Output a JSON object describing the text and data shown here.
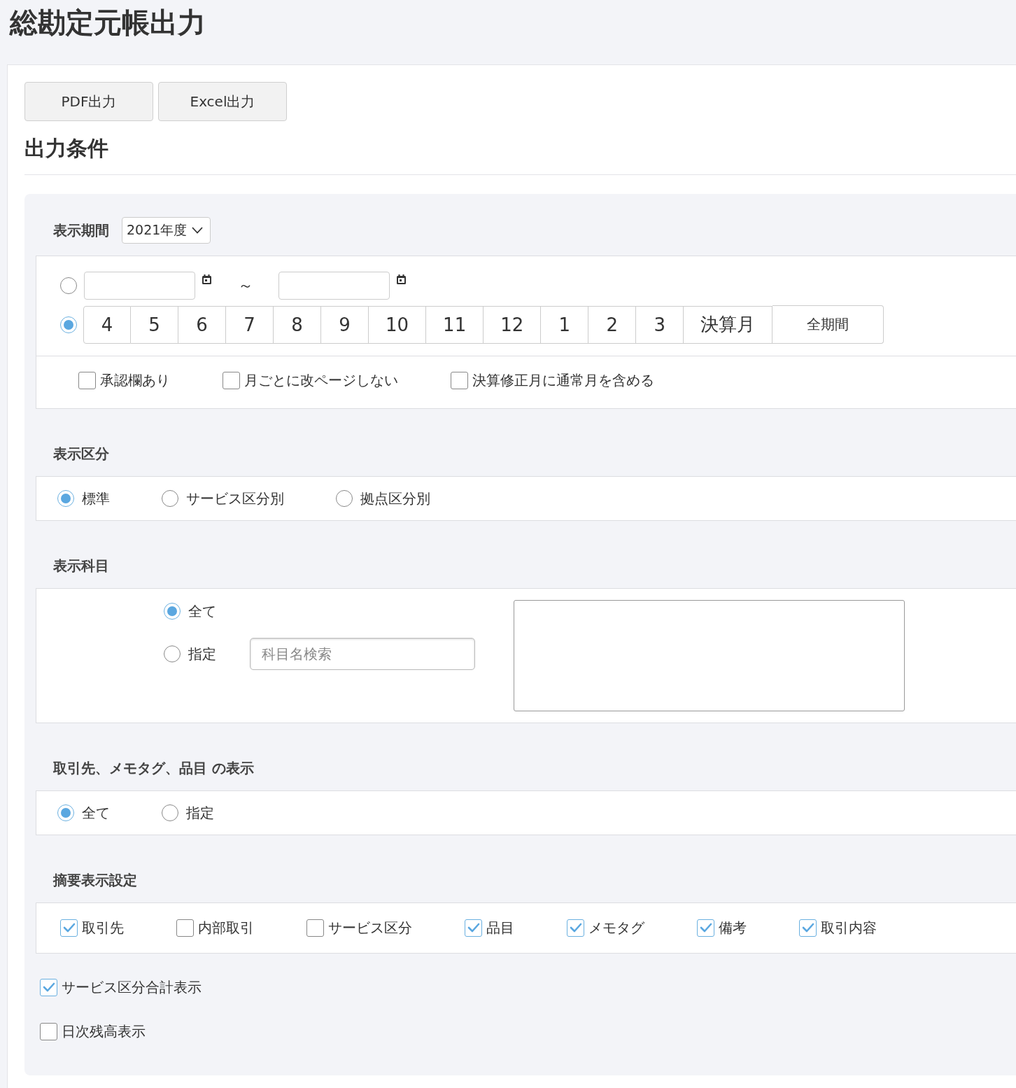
{
  "page_title": "総勘定元帳出力",
  "export_buttons": [
    "PDF出力",
    "Excel出力"
  ],
  "section_heading": "出力条件",
  "display_period": {
    "label": "表示期間",
    "fiscal_year": "2021年度",
    "modes": [
      {
        "kind": "date_range",
        "selected": false,
        "separator": "～"
      },
      {
        "kind": "month_buttons",
        "selected": true,
        "months": [
          "4",
          "5",
          "6",
          "7",
          "8",
          "9",
          "10",
          "11",
          "12",
          "1",
          "2",
          "3",
          "決算月"
        ],
        "all_label": "全期間"
      }
    ],
    "options": [
      {
        "label": "承認欄あり",
        "checked": false
      },
      {
        "label": "月ごとに改ページしない",
        "checked": false
      },
      {
        "label": "決算修正月に通常月を含める",
        "checked": false
      }
    ]
  },
  "display_category": {
    "label": "表示区分",
    "options": [
      {
        "label": "標準",
        "selected": true
      },
      {
        "label": "サービス区分別",
        "selected": false
      },
      {
        "label": "拠点区分別",
        "selected": false
      }
    ]
  },
  "display_accounts": {
    "label": "表示科目",
    "options": [
      {
        "label": "全て",
        "selected": true
      },
      {
        "label": "指定",
        "selected": false,
        "search": {
          "placeholder": "科目名検索"
        }
      }
    ]
  },
  "partner_display": {
    "label": "取引先、メモタグ、品目 の表示",
    "options": [
      {
        "label": "全て",
        "selected": true
      },
      {
        "label": "指定",
        "selected": false
      }
    ]
  },
  "summary_settings": {
    "label": "摘要表示設定",
    "options": [
      {
        "label": "取引先",
        "checked": true
      },
      {
        "label": "内部取引",
        "checked": false
      },
      {
        "label": "サービス区分",
        "checked": false
      },
      {
        "label": "品目",
        "checked": true
      },
      {
        "label": "メモタグ",
        "checked": true
      },
      {
        "label": "備考",
        "checked": true
      },
      {
        "label": "取引内容",
        "checked": true
      }
    ]
  },
  "extra_options": [
    {
      "label": "サービス区分合計表示",
      "checked": true
    },
    {
      "label": "日次残高表示",
      "checked": false
    }
  ]
}
